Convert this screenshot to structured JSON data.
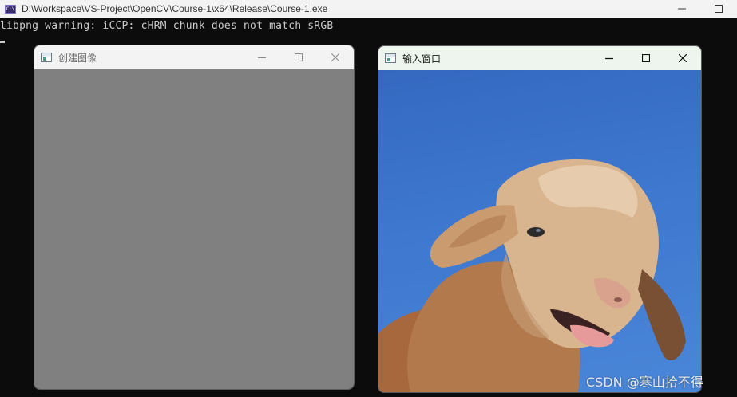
{
  "console": {
    "title": "D:\\Workspace\\VS-Project\\OpenCV\\Course-1\\x64\\Release\\Course-1.exe",
    "icon_label": "C:\\",
    "output_line": "libpng warning: iCCP: cHRM chunk does not match sRGB"
  },
  "created_window": {
    "title": "创建图像",
    "fill_color": "#808080"
  },
  "input_window": {
    "title": "输入窗口",
    "image_description": "sheep-photo"
  },
  "watermark": "CSDN @寒山拾不得"
}
